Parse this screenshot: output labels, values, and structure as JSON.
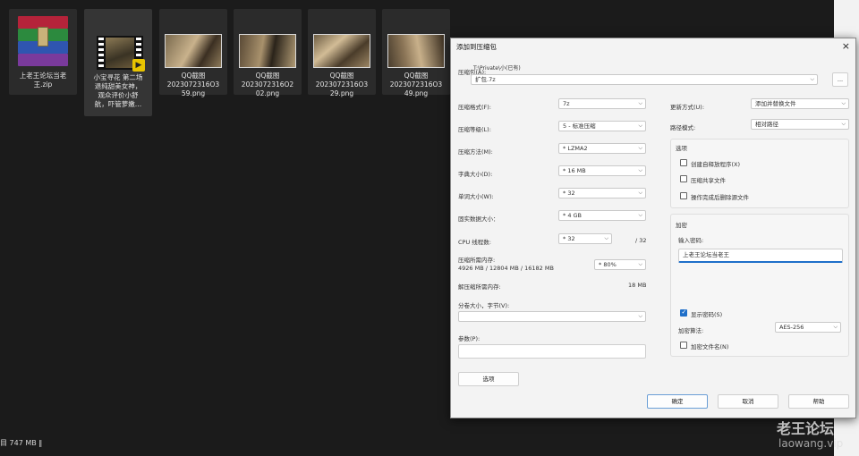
{
  "explorer": {
    "files": [
      {
        "name": "上老王论坛当老\n王.zip",
        "type": "rar"
      },
      {
        "name": "小宝寻花 第二场\n退纯甜美女神，\n观众评价小舒\n航，吓管萝嫩…",
        "type": "video"
      },
      {
        "name": "QQ截图\n2023072316O3\n59.png",
        "type": "image"
      },
      {
        "name": "QQ截图\n2023072316O2\n02.png",
        "type": "image"
      },
      {
        "name": "QQ截图\n2023072316O3\n29.png",
        "type": "image"
      },
      {
        "name": "QQ截图\n2023072316O3\n49.png",
        "type": "image"
      }
    ],
    "status": "目 747 MB ‖"
  },
  "dialog": {
    "title": "添加到压缩包",
    "close": "×",
    "archive_label": "压缩包(A):",
    "archive_path": "T:\\Private\\小(已有)",
    "archive_name": "扩包.7z",
    "browse": "...",
    "left_fields": [
      {
        "label": "压缩格式(F):",
        "value": "7z"
      },
      {
        "label": "压缩等级(L):",
        "value": "5 - 标准压缩"
      },
      {
        "label": "压缩方法(M):",
        "value": "* LZMA2"
      },
      {
        "label": "字典大小(D):",
        "value": "* 16 MB"
      },
      {
        "label": "单词大小(W):",
        "value": "* 32"
      },
      {
        "label": "固实数据大小：",
        "value": "* 4 GB"
      }
    ],
    "cpu_label": "CPU 线程数:",
    "cpu_value": "* 32",
    "cpu_max": "/ 32",
    "mem_label": "压缩所需内存:",
    "mem_detail": "4926 MB / 12804 MB / 16182 MB",
    "mem_value": "* 80%",
    "decomp_label": "解压缩所需内存:",
    "decomp_value": "18 MB",
    "split_label": "分卷大小，字节(V):",
    "params_label": "参数(P):",
    "options_btn": "选项",
    "update_label": "更新方式(U):",
    "update_value": "添加并替换文件",
    "path_label": "路径模式:",
    "path_value": "相对路径",
    "opts_group_title": "选项",
    "opts": [
      {
        "label": "创建自释放程序(X)",
        "checked": false
      },
      {
        "label": "压缩共享文件",
        "checked": false
      },
      {
        "label": "操作完成后删除源文件",
        "checked": false
      }
    ],
    "enc_group_title": "加密",
    "enc_input_label": "输入密码:",
    "password": "上老王论坛当老王",
    "show_pwd_label": "显示密码(S)",
    "enc_method_label": "加密算法:",
    "enc_method_value": "AES-256",
    "enc_names_label": "加密文件名(N)",
    "ok": "确定",
    "cancel": "取消",
    "help": "帮助"
  },
  "watermark": {
    "line1": "老王论坛",
    "line2": "laowang.vip"
  }
}
